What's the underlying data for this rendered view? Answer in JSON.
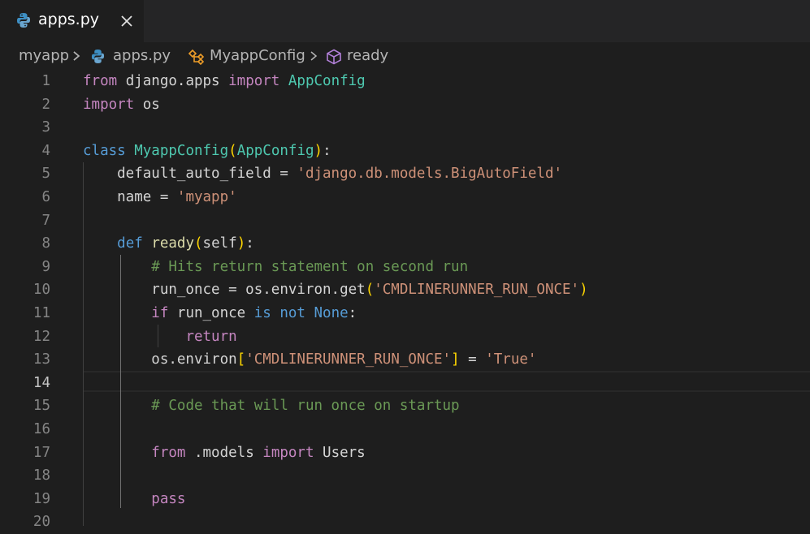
{
  "tab": {
    "title": "apps.py",
    "close_symbol": "✕"
  },
  "breadcrumb": {
    "folder": "myapp",
    "file": "apps.py",
    "class_name": "MyappConfig",
    "method": "ready"
  },
  "editor": {
    "active_line": 14,
    "lines": [
      {
        "n": "1",
        "tokens": [
          [
            "kwc",
            "from"
          ],
          [
            "pl",
            " django.apps "
          ],
          [
            "kwc",
            "import"
          ],
          [
            "pl",
            " "
          ],
          [
            "cls",
            "AppConfig"
          ]
        ]
      },
      {
        "n": "2",
        "tokens": [
          [
            "kwc",
            "import"
          ],
          [
            "pl",
            " os"
          ]
        ]
      },
      {
        "n": "3",
        "tokens": []
      },
      {
        "n": "4",
        "tokens": [
          [
            "kw",
            "class"
          ],
          [
            "pl",
            " "
          ],
          [
            "cls",
            "MyappConfig"
          ],
          [
            "br1",
            "("
          ],
          [
            "cls",
            "AppConfig"
          ],
          [
            "br1",
            ")"
          ],
          [
            "pl",
            ":"
          ]
        ]
      },
      {
        "n": "5",
        "tokens": [
          [
            "pl",
            "    default_auto_field = "
          ],
          [
            "str",
            "'django.db.models.BigAutoField'"
          ]
        ]
      },
      {
        "n": "6",
        "tokens": [
          [
            "pl",
            "    name = "
          ],
          [
            "str",
            "'myapp'"
          ]
        ]
      },
      {
        "n": "7",
        "tokens": []
      },
      {
        "n": "8",
        "tokens": [
          [
            "pl",
            "    "
          ],
          [
            "kw",
            "def"
          ],
          [
            "pl",
            " "
          ],
          [
            "fn",
            "ready"
          ],
          [
            "br1",
            "("
          ],
          [
            "pl",
            "self"
          ],
          [
            "br1",
            ")"
          ],
          [
            "pl",
            ":"
          ]
        ]
      },
      {
        "n": "9",
        "tokens": [
          [
            "pl",
            "        "
          ],
          [
            "cm",
            "# Hits return statement on second run"
          ]
        ]
      },
      {
        "n": "10",
        "tokens": [
          [
            "pl",
            "        run_once = os.environ.get"
          ],
          [
            "br1",
            "("
          ],
          [
            "str",
            "'CMDLINERUNNER_RUN_ONCE'"
          ],
          [
            "br1",
            ")"
          ]
        ]
      },
      {
        "n": "11",
        "tokens": [
          [
            "pl",
            "        "
          ],
          [
            "kwc",
            "if"
          ],
          [
            "pl",
            " run_once "
          ],
          [
            "kw",
            "is"
          ],
          [
            "pl",
            " "
          ],
          [
            "kw",
            "not"
          ],
          [
            "pl",
            " "
          ],
          [
            "kw",
            "None"
          ],
          [
            "pl",
            ":"
          ]
        ]
      },
      {
        "n": "12",
        "tokens": [
          [
            "pl",
            "            "
          ],
          [
            "kwc",
            "return"
          ]
        ]
      },
      {
        "n": "13",
        "tokens": [
          [
            "pl",
            "        os.environ"
          ],
          [
            "br1",
            "["
          ],
          [
            "str",
            "'CMDLINERUNNER_RUN_ONCE'"
          ],
          [
            "br1",
            "]"
          ],
          [
            "pl",
            " = "
          ],
          [
            "str",
            "'True'"
          ]
        ]
      },
      {
        "n": "14",
        "tokens": []
      },
      {
        "n": "15",
        "tokens": [
          [
            "pl",
            "        "
          ],
          [
            "cm",
            "# Code that will run once on startup"
          ]
        ]
      },
      {
        "n": "16",
        "tokens": []
      },
      {
        "n": "17",
        "tokens": [
          [
            "pl",
            "        "
          ],
          [
            "kwc",
            "from"
          ],
          [
            "pl",
            " .models "
          ],
          [
            "kwc",
            "import"
          ],
          [
            "pl",
            " Users"
          ]
        ]
      },
      {
        "n": "18",
        "tokens": []
      },
      {
        "n": "19",
        "tokens": [
          [
            "pl",
            "        "
          ],
          [
            "kwc",
            "pass"
          ]
        ]
      },
      {
        "n": "20",
        "tokens": []
      }
    ]
  },
  "colors": {
    "editor_bg": "#1e1e1e",
    "tabbar_bg": "#252526",
    "keyword_blue": "#569cd6",
    "keyword_control": "#c586c0",
    "string": "#ce9178",
    "comment": "#6a9955",
    "class": "#4ec9b0",
    "function": "#dcdcaa",
    "bracket": "#ffd700"
  },
  "icons": {
    "tab_icon": "python-icon",
    "class_icon": "symbol-class-icon",
    "method_icon": "symbol-method-icon"
  }
}
